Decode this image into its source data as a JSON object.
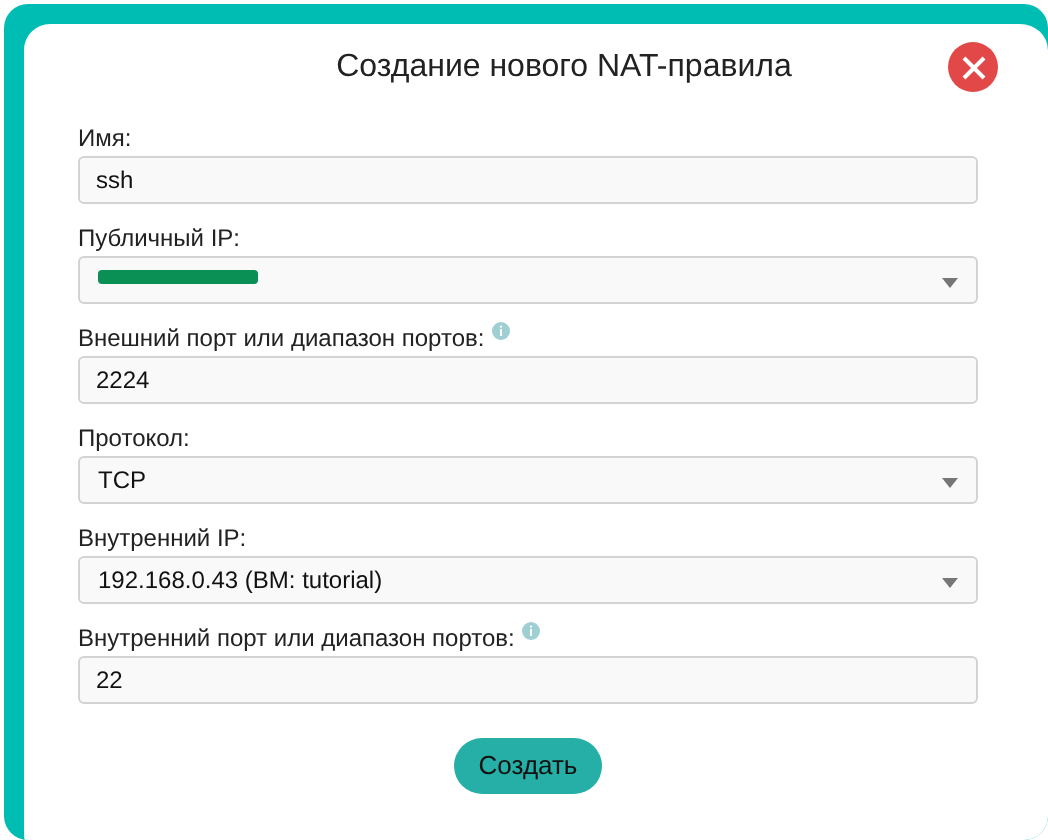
{
  "dialog": {
    "title": "Создание нового NAT-правила"
  },
  "fields": [
    {
      "kind": "text",
      "label": "Имя:",
      "value": "ssh",
      "info": false
    },
    {
      "kind": "select",
      "label": "Публичный IP:",
      "redacted": true,
      "info": false
    },
    {
      "kind": "text",
      "label": "Внешний порт или диапазон портов:",
      "value": "2224",
      "info": true
    },
    {
      "kind": "select",
      "label": "Протокол:",
      "value": "TCP",
      "info": false
    },
    {
      "kind": "select",
      "label": "Внутренний IP:",
      "value": "192.168.0.43 (ВМ: tutorial)",
      "info": false
    },
    {
      "kind": "text",
      "label": "Внутренний порт или диапазон портов:",
      "value": "22",
      "info": true
    }
  ],
  "submit_button": "Создать"
}
